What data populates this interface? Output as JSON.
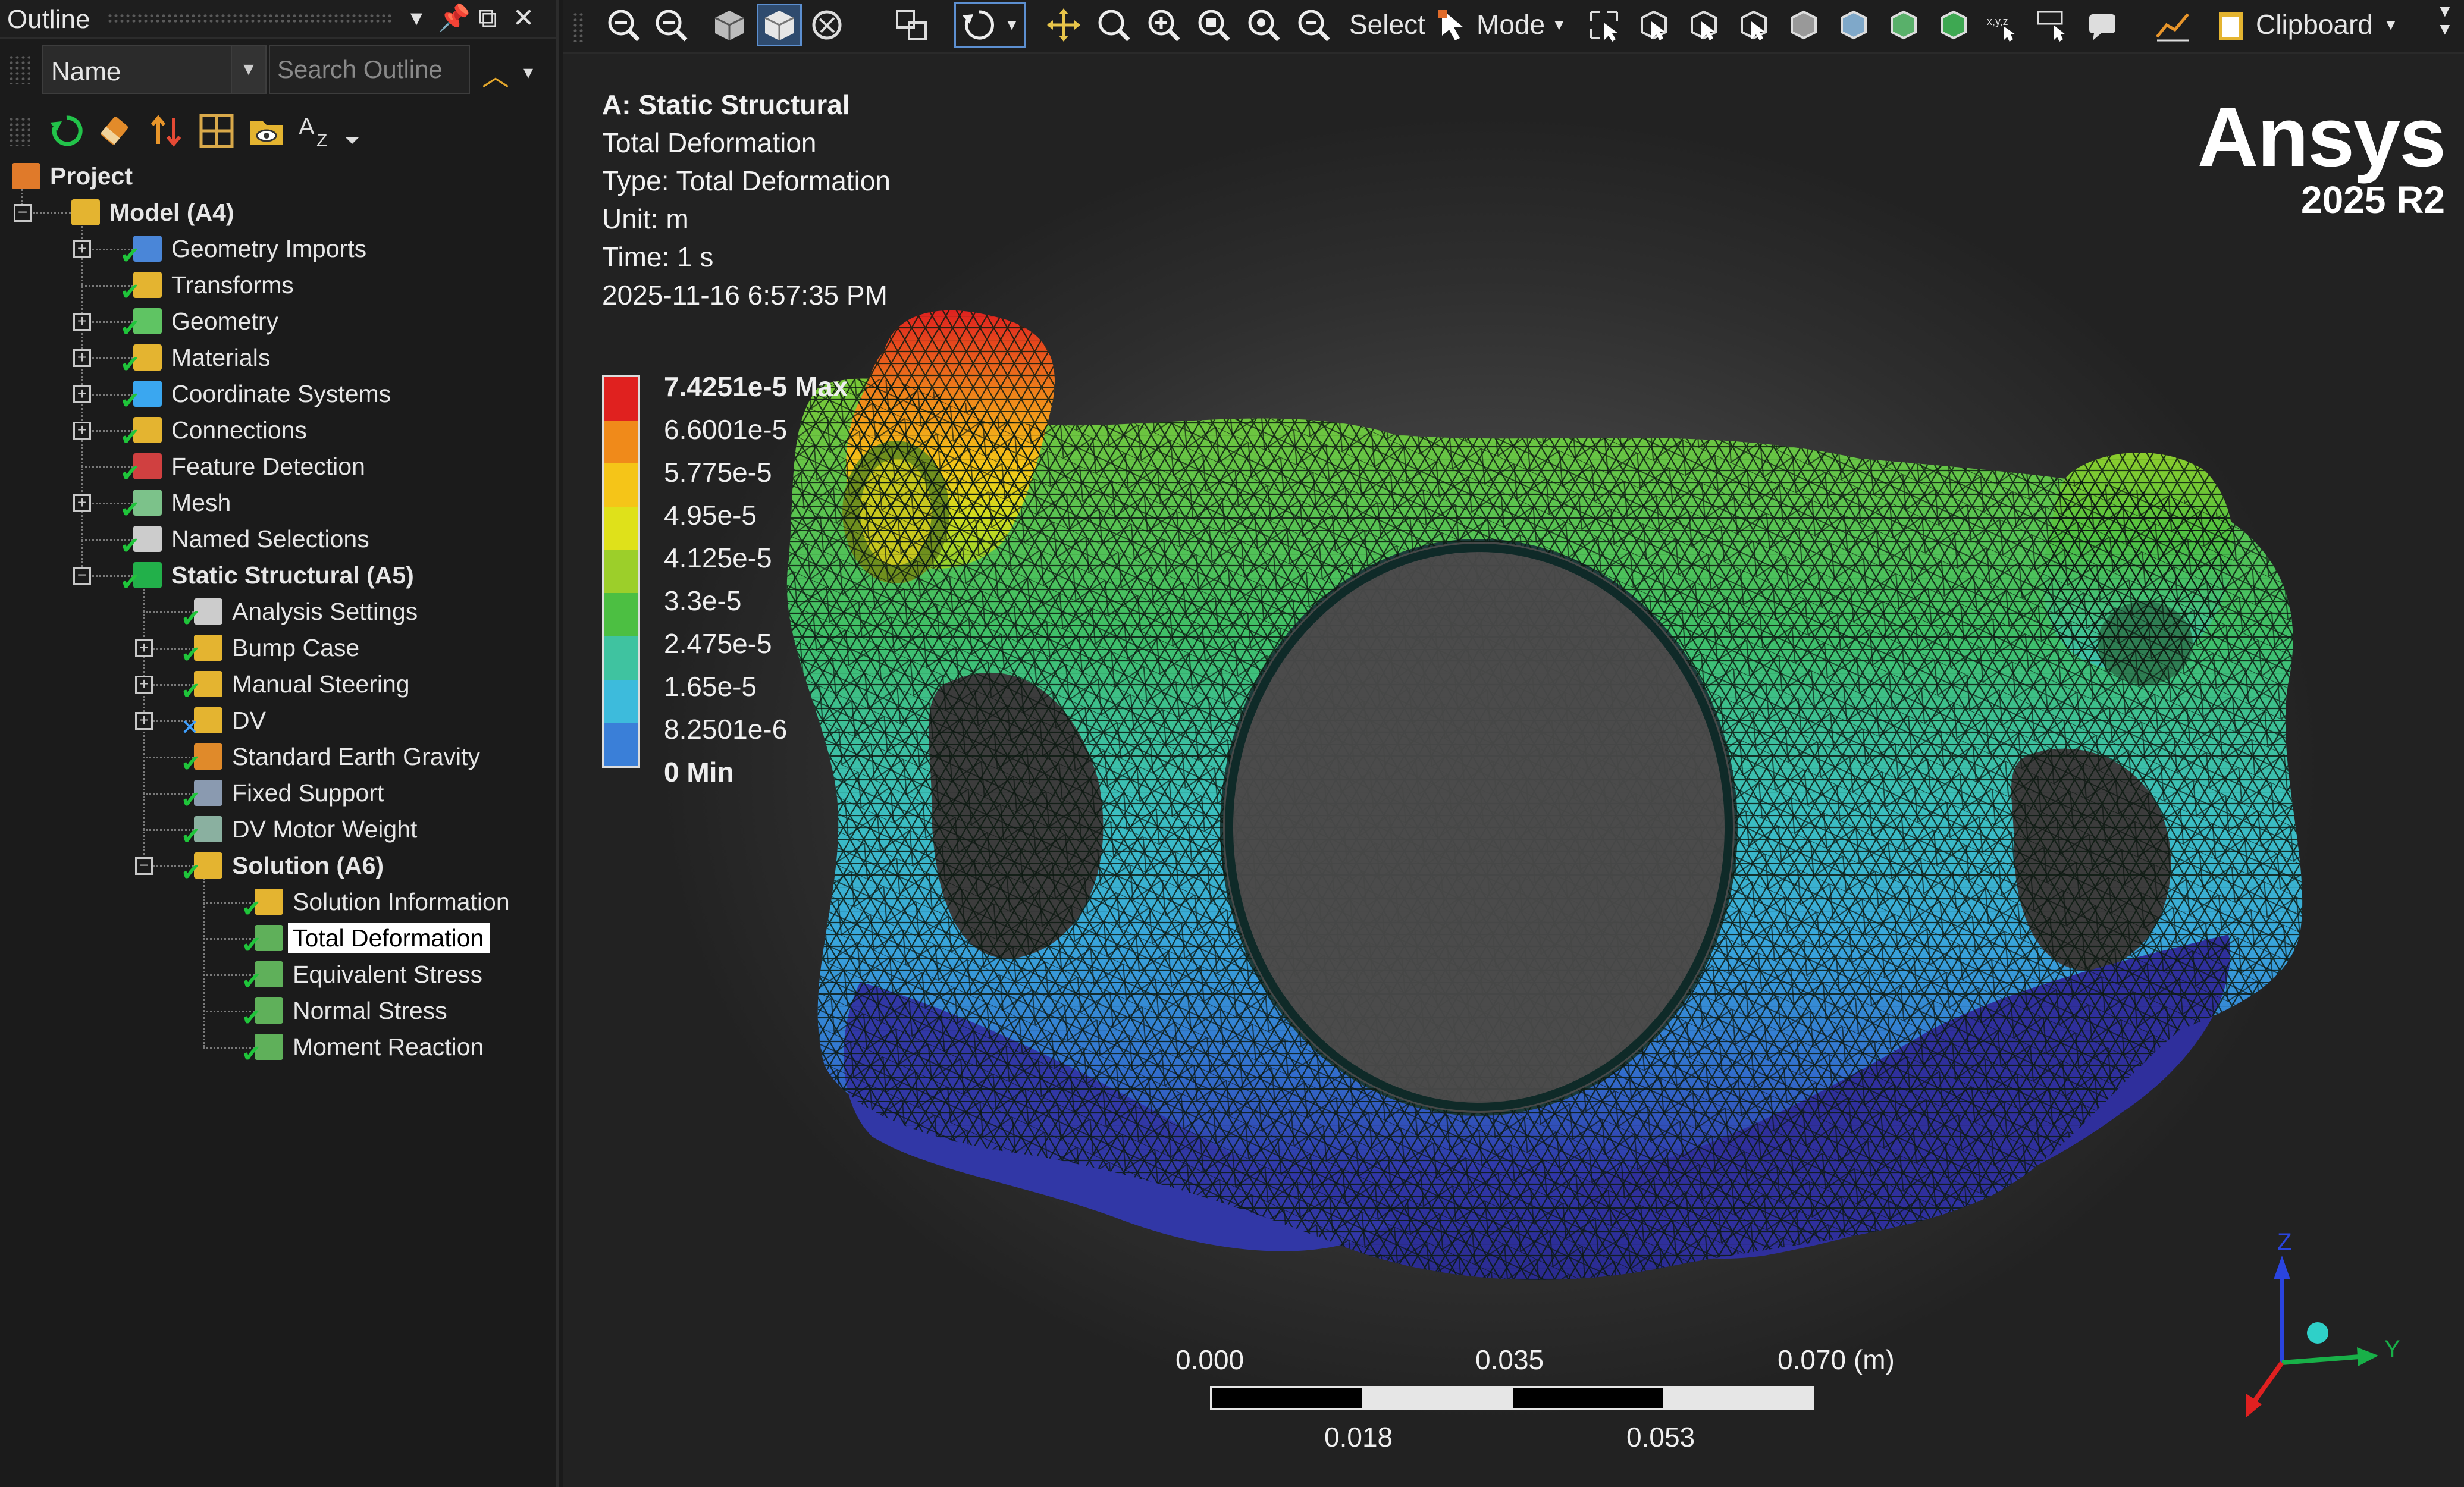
{
  "outline": {
    "title": "Outline",
    "name_select": "Name",
    "search_placeholder": "Search Outline",
    "tree": [
      {
        "label": "Project",
        "bold": true,
        "level": 0
      },
      {
        "label": "Model (A4)",
        "bold": true,
        "level": 1
      },
      {
        "label": "Geometry Imports",
        "level": 2
      },
      {
        "label": "Transforms",
        "level": 2
      },
      {
        "label": "Geometry",
        "level": 2
      },
      {
        "label": "Materials",
        "level": 2
      },
      {
        "label": "Coordinate Systems",
        "level": 2
      },
      {
        "label": "Connections",
        "level": 2
      },
      {
        "label": "Feature Detection",
        "level": 2
      },
      {
        "label": "Mesh",
        "level": 2
      },
      {
        "label": "Named Selections",
        "level": 2
      },
      {
        "label": "Static Structural (A5)",
        "bold": true,
        "level": 2
      },
      {
        "label": "Analysis Settings",
        "level": 3
      },
      {
        "label": "Bump Case",
        "level": 3
      },
      {
        "label": "Manual Steering",
        "level": 3
      },
      {
        "label": "DV",
        "level": 3
      },
      {
        "label": "Standard Earth Gravity",
        "level": 3
      },
      {
        "label": "Fixed Support",
        "level": 3
      },
      {
        "label": "DV Motor Weight",
        "level": 3
      },
      {
        "label": "Solution (A6)",
        "bold": true,
        "level": 3
      },
      {
        "label": "Solution Information",
        "level": 4
      },
      {
        "label": "Total Deformation",
        "level": 4,
        "selected": true
      },
      {
        "label": "Equivalent Stress",
        "level": 4
      },
      {
        "label": "Normal Stress",
        "level": 4
      },
      {
        "label": "Moment Reaction",
        "level": 4
      }
    ]
  },
  "toolbar": {
    "select_label": "Select",
    "mode_label": "Mode",
    "clipboard_label": "Clipboard"
  },
  "viewport": {
    "analysis": "A: Static Structural",
    "result": "Total Deformation",
    "type": "Type: Total Deformation",
    "unit": "Unit: m",
    "time": "Time: 1 s",
    "timestamp": "2025-11-16 6:57:35 PM",
    "legend": [
      {
        "label": "7.4251e-5 Max",
        "color": "#e0211f"
      },
      {
        "label": "6.6001e-5",
        "color": "#f08a1a"
      },
      {
        "label": "5.775e-5",
        "color": "#f5c518"
      },
      {
        "label": "4.95e-5",
        "color": "#dfe11a"
      },
      {
        "label": "4.125e-5",
        "color": "#9ccf2a"
      },
      {
        "label": "3.3e-5",
        "color": "#4cbf42"
      },
      {
        "label": "2.475e-5",
        "color": "#3fc3a0"
      },
      {
        "label": "1.65e-5",
        "color": "#3dbbdc"
      },
      {
        "label": "8.2501e-6",
        "color": "#3a7fd8"
      },
      {
        "label": "0 Min",
        "color": "#2f2fa8"
      }
    ],
    "brand": "Ansys",
    "version": "2025 R2",
    "scale": {
      "top_labels": [
        "0.000",
        "0.035",
        "0.070 (m)"
      ],
      "bottom_labels": [
        "0.018",
        "0.053"
      ]
    },
    "triad": {
      "z": "Z",
      "y": "Y"
    }
  }
}
